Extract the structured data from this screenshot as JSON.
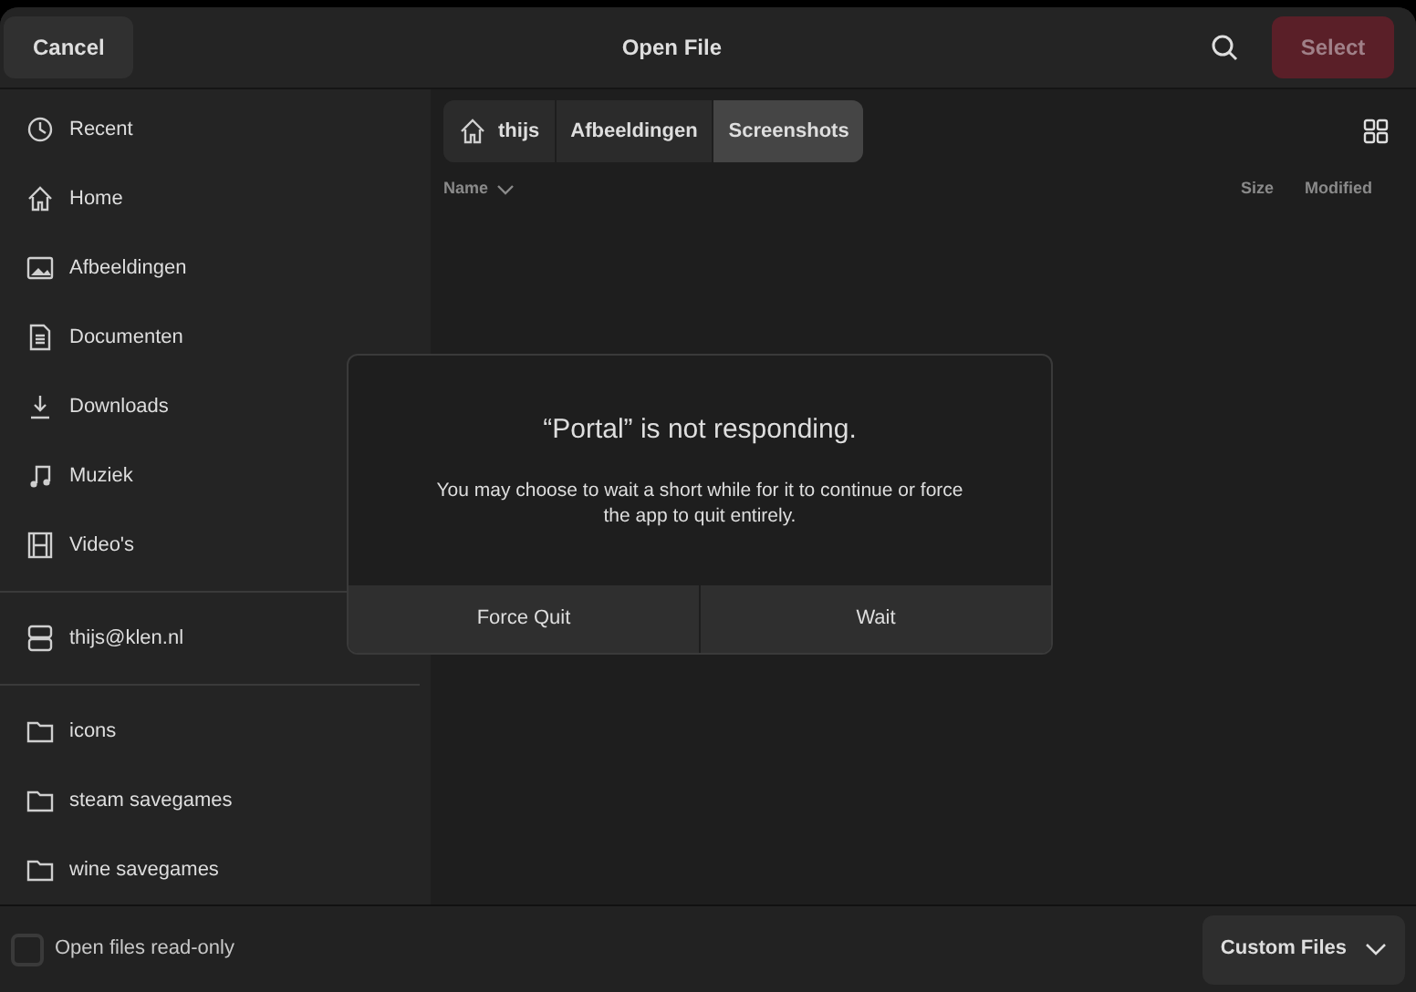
{
  "header": {
    "cancel": "Cancel",
    "title": "Open File",
    "select": {
      "label": "Select",
      "disabled": true
    }
  },
  "sidebar": {
    "places": [
      {
        "label": "Recent"
      },
      {
        "label": "Home"
      },
      {
        "label": "Afbeeldingen"
      },
      {
        "label": "Documenten"
      },
      {
        "label": "Downloads"
      },
      {
        "label": "Muziek"
      },
      {
        "label": "Video's"
      }
    ],
    "network": [
      {
        "label": "thijs@klen.nl"
      }
    ],
    "bookmarks": [
      {
        "label": "icons"
      },
      {
        "label": "steam savegames"
      },
      {
        "label": "wine savegames"
      }
    ]
  },
  "breadcrumb": [
    {
      "label": "thijs",
      "selected": false
    },
    {
      "label": "Afbeeldingen",
      "selected": false
    },
    {
      "label": "Screenshots",
      "selected": true
    }
  ],
  "columns": [
    "Name",
    "Size",
    "Modified"
  ],
  "dialog": {
    "title": "“Portal” is not responding.",
    "message": "You may choose to wait a short while for it to continue or force the app to quit entirely.",
    "buttons": [
      "Force Quit",
      "Wait"
    ]
  },
  "footer": {
    "read_only": {
      "label": "Open files read-only",
      "checked": false
    },
    "filter": "Custom Files"
  }
}
